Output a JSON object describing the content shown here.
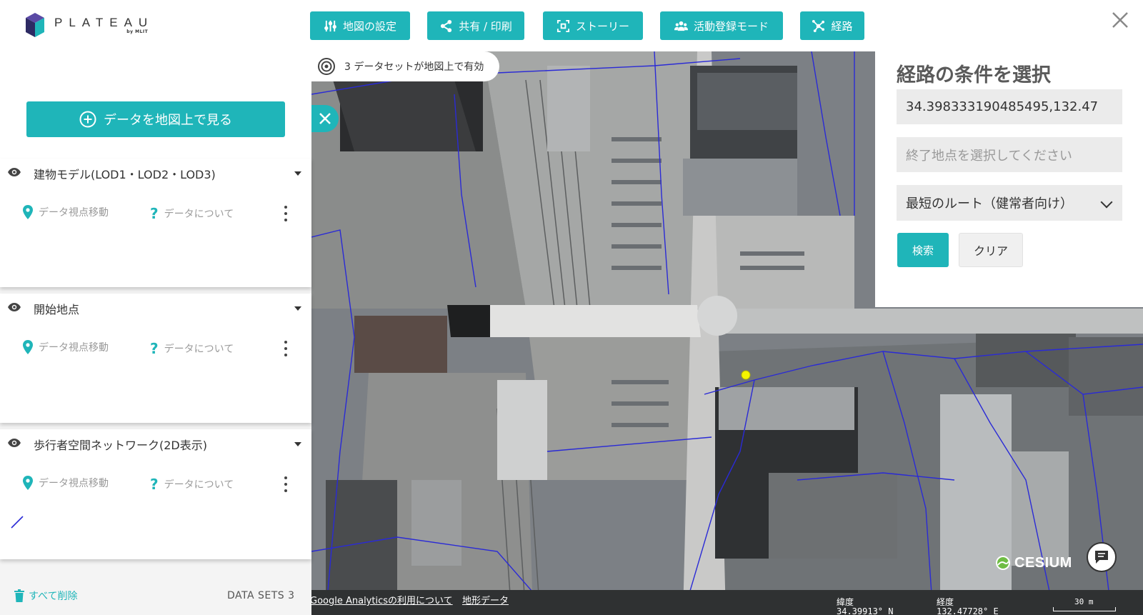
{
  "app": {
    "logo_text": "PLATEAU",
    "logo_sub": "by MLIT"
  },
  "toolbar": [
    {
      "label": "地図の設定",
      "icon": "sliders-icon"
    },
    {
      "label": "共有 / 印刷",
      "icon": "share-icon"
    },
    {
      "label": "ストーリー",
      "icon": "story-icon"
    },
    {
      "label": "活動登録モード",
      "icon": "people-icon"
    },
    {
      "label": "経路",
      "icon": "route-icon"
    }
  ],
  "left_panel": {
    "view_button": "データを地図上で見る",
    "layers": [
      {
        "title": "建物モデル(LOD1・LOD2・LOD3)",
        "move": "データ視点移動",
        "about": "データについて"
      },
      {
        "title": "開始地点",
        "move": "データ視点移動",
        "about": "データについて"
      },
      {
        "title": "歩行者空間ネットワーク(2D表示)",
        "move": "データ視点移動",
        "about": "データについて"
      }
    ],
    "delete_all": "すべて削除",
    "datasets": "DATA SETS 3"
  },
  "map": {
    "dataset_pill": "3 データセットが地図上で有効",
    "attribution_analytics": "Google Analyticsの利用について",
    "attribution_terrain": "地形データ",
    "lat_label": "緯度",
    "lat_value": "34.39913° N",
    "lon_label": "経度",
    "lon_value": "132.47728° E",
    "scale": "30 m",
    "cesium_text": "CESIUM"
  },
  "route_panel": {
    "title": "経路の条件を選択",
    "start_value": "34.398333190485495,132.47",
    "end_placeholder": "終了地点を選択してください",
    "route_option": "最短のルート（健常者向け）",
    "search_label": "検索",
    "clear_label": "クリア"
  },
  "colors": {
    "accent": "#1fb5b9",
    "network_line": "#2a2ad6",
    "start_marker": "#f5f500"
  }
}
